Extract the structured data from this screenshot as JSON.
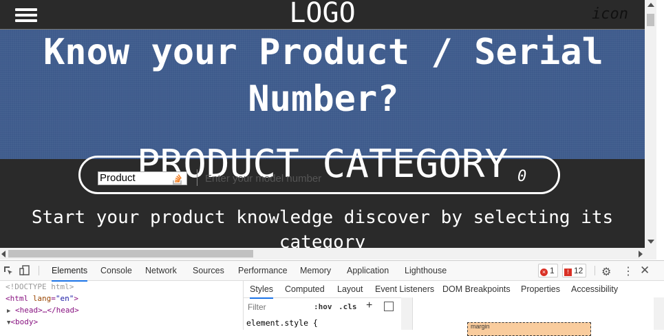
{
  "page": {
    "logo": "LOGO",
    "top_icon_text": "icon",
    "hero_title": "Know your Product / Serial Number?",
    "category_title": "PRODUCT CATEGORY",
    "search": {
      "select_value": "Product",
      "placeholder": "Enter your model number",
      "zero_label": "0"
    },
    "description": "Start your product knowledge discover by selecting its category",
    "colors": {
      "hero_bg": "#3e5b8c",
      "page_bg": "#2a2a2a"
    }
  },
  "devtools": {
    "tabs": [
      "Elements",
      "Console",
      "Network",
      "Sources",
      "Performance",
      "Memory",
      "Application",
      "Lighthouse"
    ],
    "active_tab": "Elements",
    "errors_count": "1",
    "issues_count": "12",
    "dom_lines": {
      "doctype": "<!DOCTYPE html>",
      "html_open": "<html",
      "html_attr": "lang",
      "html_val": "\"en\"",
      "html_close": ">",
      "head": "<head>…</head>",
      "body": "<body>"
    },
    "styles_tabs": [
      "Styles",
      "Computed",
      "Layout",
      "Event Listeners",
      "DOM Breakpoints",
      "Properties",
      "Accessibility"
    ],
    "filter_placeholder": "Filter",
    "hov": ":hov",
    "cls": ".cls",
    "element_style": "element.style {",
    "box_model_label": "margin"
  }
}
